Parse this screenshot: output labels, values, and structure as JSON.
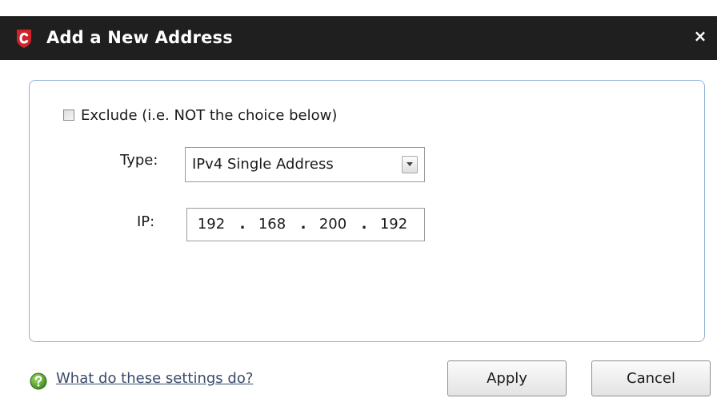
{
  "window": {
    "title": "Add a New Address",
    "close_glyph": "×"
  },
  "icons": {
    "app": "comodo-shield-icon",
    "close": "close-icon",
    "help": "help-question-icon",
    "dropdown": "chevron-down-icon"
  },
  "form": {
    "exclude_label": "Exclude (i.e. NOT the choice below)",
    "exclude_checked": false,
    "type_label": "Type:",
    "type_value": "IPv4 Single Address",
    "ip_label": "IP:",
    "ip_octets": [
      "192",
      "168",
      "200",
      "192"
    ],
    "ip_separator": "."
  },
  "footer": {
    "help_link": "What do these settings do?",
    "apply_label": "Apply",
    "cancel_label": "Cancel"
  },
  "colors": {
    "titlebar": "#1f1f1f",
    "logo_red": "#d2232a",
    "group_border": "#8fb3d6",
    "help_green": "#5aa02c",
    "link": "#3a4a6b"
  }
}
